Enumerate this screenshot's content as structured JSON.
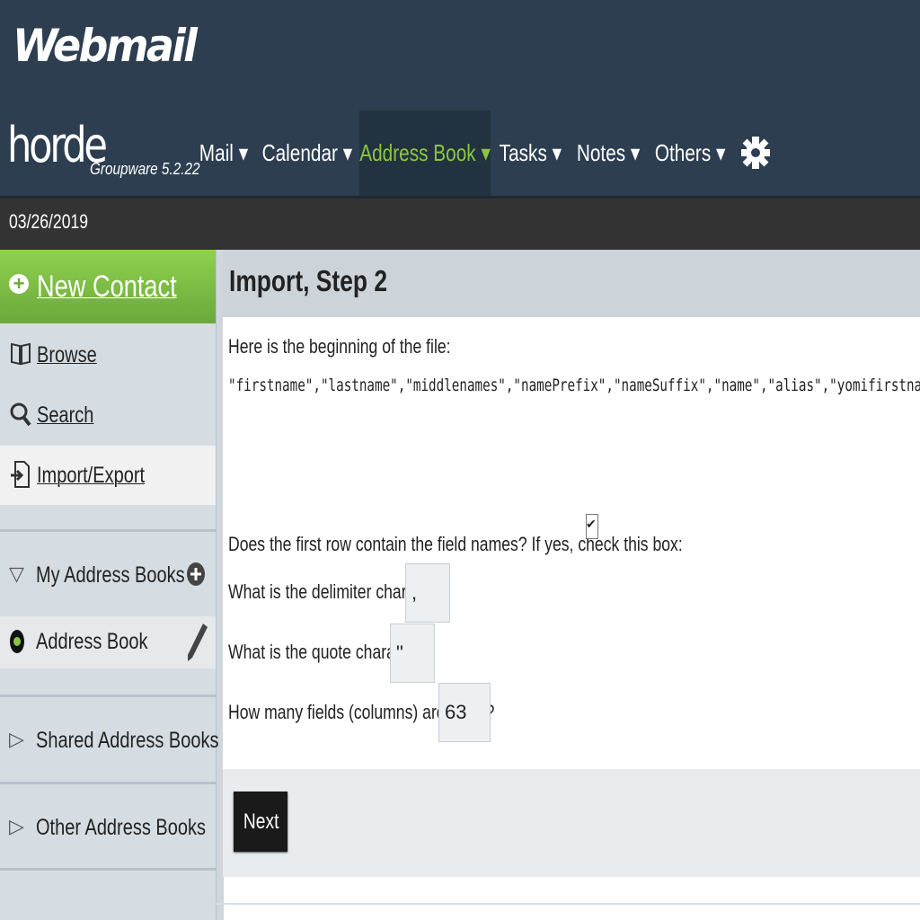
{
  "header": {
    "brand": "Webmail",
    "logo_word": "horde",
    "logo_sub": "Groupware 5.2.22"
  },
  "nav": {
    "items": [
      {
        "label": "Mail ▾"
      },
      {
        "label": "Calendar ▾"
      },
      {
        "label": "Address Book ▾",
        "active": true
      },
      {
        "label": "Tasks ▾"
      },
      {
        "label": "Notes ▾"
      },
      {
        "label": "Others ▾"
      }
    ],
    "settings_icon": "gear-icon"
  },
  "date": "03/26/2019",
  "sidebar": {
    "new_contact": "New Contact",
    "items": [
      {
        "label": "Browse",
        "icon": "book-icon"
      },
      {
        "label": "Search",
        "icon": "search-icon"
      },
      {
        "label": "Import/Export",
        "icon": "import-export-icon",
        "selected": true
      }
    ],
    "sections": {
      "my": "My Address Books",
      "shared": "Shared Address Books",
      "other": "Other Address Books"
    },
    "address_book": "Address Book"
  },
  "main": {
    "title": "Import, Step 2",
    "intro": "Here is the beginning of the file:",
    "file_preview": "\"firstname\",\"lastname\",\"middlenames\",\"namePrefix\",\"nameSuffix\",\"name\",\"alias\",\"yomifirstname\",\"yo...",
    "q_header_row": "Does the first row contain the field names? If yes, check this box:",
    "header_row_checked": true,
    "q_delimiter": "What is the delimiter character?",
    "delimiter_value": ",",
    "q_quote": "What is the quote character?",
    "quote_value": "\"",
    "q_fields": "How many fields (columns) are there?",
    "fields_value": "63",
    "next_label": "Next"
  },
  "colors": {
    "header_bg": "#2c3e50",
    "active_nav": "#8cc63f",
    "new_contact_green": "#7dbb45",
    "sidebar_bg": "#d6dde2"
  }
}
